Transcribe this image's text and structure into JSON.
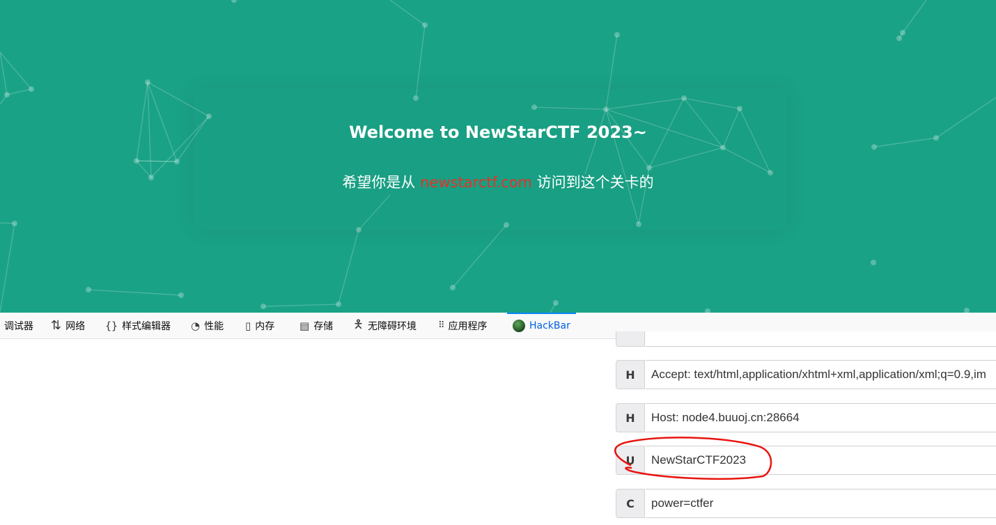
{
  "page": {
    "title": "Welcome to NewStarCTF 2023~",
    "message_before": "希望你是从 ",
    "message_link": "newstarctf.com",
    "message_after": " 访问到这个关卡的"
  },
  "colors": {
    "page_background": "#1aa286",
    "link": "#e53226",
    "devtools_active": "#0060df"
  },
  "devtools": {
    "tabs": [
      {
        "label": "调试器",
        "icon": "debugger-icon"
      },
      {
        "label": "网络",
        "icon": "network-arrows-icon"
      },
      {
        "label": "样式编辑器",
        "icon": "braces-icon"
      },
      {
        "label": "性能",
        "icon": "gauge-icon"
      },
      {
        "label": "内存",
        "icon": "memory-chip-icon"
      },
      {
        "label": "存储",
        "icon": "storage-icon"
      },
      {
        "label": "无障碍环境",
        "icon": "accessibility-icon"
      },
      {
        "label": "应用程序",
        "icon": "grid-icon"
      },
      {
        "label": "HackBar",
        "icon": "hackbar-logo-icon",
        "active": true
      }
    ]
  },
  "hackbar": {
    "headers": [
      {
        "type": "H",
        "value": "Accept: text/html,application/xhtml+xml,application/xml;q=0.9,im"
      },
      {
        "type": "H",
        "value": "Host: node4.buuoj.cn:28664"
      },
      {
        "type": "U",
        "value": "NewStarCTF2023"
      },
      {
        "type": "C",
        "value": "power=ctfer"
      }
    ]
  }
}
